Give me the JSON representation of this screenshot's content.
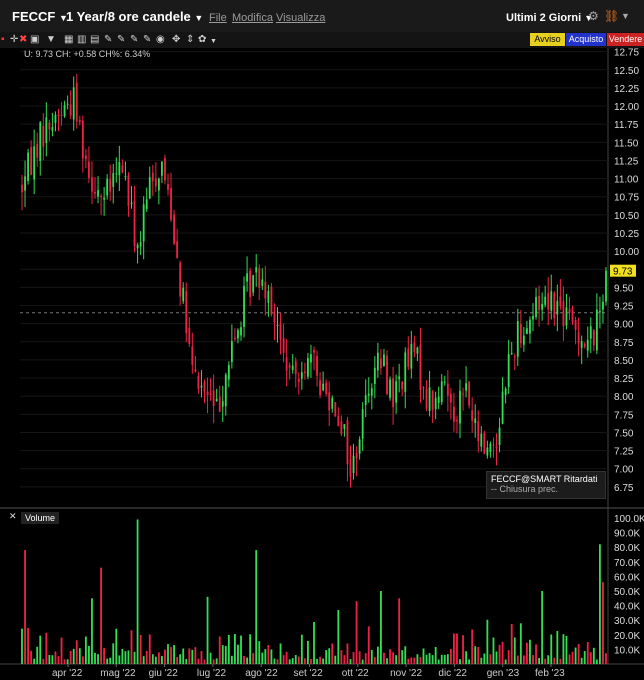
{
  "header": {
    "symbol": "FECCF",
    "period": "1 Year/8 ore candele",
    "menu": [
      "File",
      "Modifica",
      "Visualizza"
    ],
    "range": "Ultimi 2 Giorni"
  },
  "toolbar": {
    "avviso": "Avviso",
    "acquisto": "Acquisto",
    "vendere": "Vendere"
  },
  "quote": {
    "text": "U: 9.73 CH: +0.58 CH%: 6.34%"
  },
  "legend": {
    "title": "FECCF@SMART Ritardati",
    "line": "-- Chiusura prec."
  },
  "volume_panel": {
    "title": "Volume"
  },
  "colors": {
    "up": "#33dd55",
    "down": "#ee2244",
    "accent": "#f0e020",
    "button_blue": "#2233cc",
    "button_red": "#cc2222",
    "button_yellow": "#e8d020"
  },
  "chart_data": {
    "type": "candlestick",
    "price_axis": {
      "ylim": [
        6.5,
        12.8
      ],
      "ticks": [
        12.75,
        12.5,
        12.25,
        12.0,
        11.75,
        11.5,
        11.25,
        11.0,
        10.75,
        10.5,
        10.25,
        10.0,
        9.75,
        9.5,
        9.25,
        9.0,
        8.75,
        8.5,
        8.25,
        8.0,
        7.75,
        7.5,
        7.25,
        7.0,
        6.75
      ]
    },
    "volume_axis": {
      "ylim": [
        0,
        100000
      ],
      "ticks": [
        "100.0K",
        "90.0K",
        "80.0K",
        "70.0K",
        "60.0K",
        "50.0K",
        "40.0K",
        "30.0K",
        "20.0K",
        "10.0K"
      ]
    },
    "x_labels": [
      "apr '22",
      "mag '22",
      "giu '22",
      "lug '22",
      "ago '22",
      "set '22",
      "ott '22",
      "nov '22",
      "dic '22",
      "gen '23",
      "feb '23"
    ],
    "last_price": 9.73,
    "prev_close": 9.15,
    "price_path": [
      [
        0,
        10.9
      ],
      [
        6,
        11.6
      ],
      [
        12,
        11.9
      ],
      [
        17,
        12.1
      ],
      [
        22,
        11.1
      ],
      [
        27,
        10.7
      ],
      [
        33,
        11.2
      ],
      [
        38,
        10.0
      ],
      [
        42,
        10.9
      ],
      [
        46,
        11.2
      ],
      [
        49,
        10.6
      ],
      [
        52,
        9.6
      ],
      [
        56,
        8.3
      ],
      [
        61,
        8.0
      ],
      [
        64,
        7.8
      ],
      [
        68,
        8.5
      ],
      [
        71,
        8.9
      ],
      [
        74,
        9.5
      ],
      [
        78,
        9.7
      ],
      [
        81,
        9.5
      ],
      [
        85,
        8.7
      ],
      [
        89,
        8.2
      ],
      [
        92,
        8.5
      ],
      [
        96,
        8.4
      ],
      [
        99,
        8.1
      ],
      [
        103,
        7.9
      ],
      [
        106,
        7.5
      ],
      [
        108,
        6.9
      ],
      [
        111,
        7.5
      ],
      [
        114,
        8.2
      ],
      [
        118,
        8.5
      ],
      [
        122,
        8.0
      ],
      [
        126,
        8.4
      ],
      [
        129,
        8.6
      ],
      [
        133,
        8.0
      ],
      [
        136,
        7.9
      ],
      [
        139,
        8.2
      ],
      [
        142,
        7.8
      ],
      [
        146,
        8.1
      ],
      [
        149,
        7.5
      ],
      [
        152,
        7.3
      ],
      [
        156,
        7.4
      ],
      [
        159,
        8.3
      ],
      [
        163,
        8.9
      ],
      [
        166,
        9.0
      ],
      [
        170,
        9.3
      ],
      [
        173,
        9.4
      ],
      [
        177,
        9.2
      ],
      [
        180,
        9.0
      ],
      [
        183,
        8.9
      ],
      [
        186,
        8.7
      ],
      [
        189,
        9.0
      ],
      [
        192,
        9.73
      ]
    ],
    "volume_spikes": [
      {
        "i": 1,
        "v": 78000,
        "dir": "down"
      },
      {
        "i": 23,
        "v": 45000,
        "dir": "up"
      },
      {
        "i": 26,
        "v": 66000,
        "dir": "down"
      },
      {
        "i": 38,
        "v": 99000,
        "dir": "up"
      },
      {
        "i": 61,
        "v": 46000,
        "dir": "up"
      },
      {
        "i": 77,
        "v": 78000,
        "dir": "up"
      },
      {
        "i": 104,
        "v": 37000,
        "dir": "up"
      },
      {
        "i": 110,
        "v": 43000,
        "dir": "down"
      },
      {
        "i": 118,
        "v": 50000,
        "dir": "up"
      },
      {
        "i": 124,
        "v": 45000,
        "dir": "down"
      },
      {
        "i": 171,
        "v": 50000,
        "dir": "up"
      },
      {
        "i": 190,
        "v": 82000,
        "dir": "up"
      },
      {
        "i": 191,
        "v": 56000,
        "dir": "down"
      }
    ]
  }
}
